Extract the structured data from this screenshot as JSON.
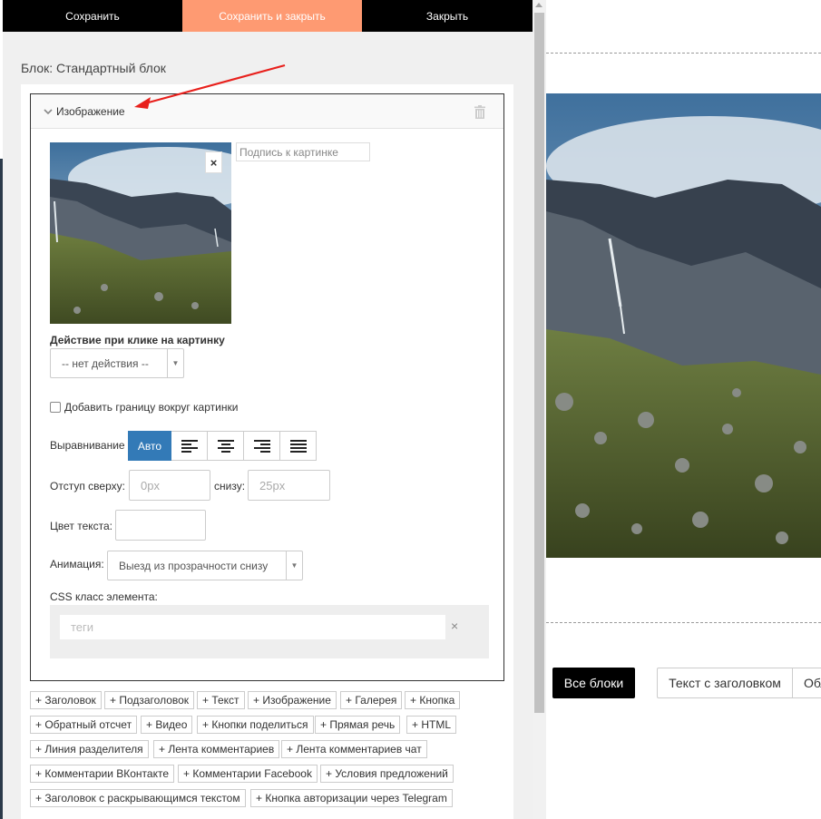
{
  "toolbar": {
    "save_label": "Сохранить",
    "save_close_label": "Сохранить и закрыть",
    "close_label": "Закрыть"
  },
  "block": {
    "title": "Блок: Стандартный блок"
  },
  "image_card": {
    "title": "Изображение",
    "remove_label": "×",
    "caption_placeholder": "Подпись к картинке",
    "click_action_label": "Действие при клике на картинку",
    "click_action_value": "-- нет действия --",
    "border_checkbox_label": "Добавить границу вокруг картинки",
    "border_checked": false,
    "align_label": "Выравнивание",
    "align_auto_label": "Авто",
    "margin_top_label": "Отступ сверху:",
    "margin_top_placeholder": "0px",
    "margin_bottom_label": "снизу:",
    "margin_bottom_placeholder": "25px",
    "text_color_label": "Цвет текста:",
    "animation_label": "Анимация:",
    "animation_value": "Выезд из прозрачности снизу",
    "css_class_label": "CSS класс элемента:",
    "tags_placeholder": "теги",
    "tags_clear": "×"
  },
  "add_buttons": [
    "+ Заголовок",
    "+ Подзаголовок",
    "+ Текст",
    "+ Изображение",
    "+ Галерея",
    "+ Кнопка",
    "+ Обратный отсчет",
    "+ Видео",
    "+ Кнопки поделиться",
    "+ Прямая речь",
    "+ HTML",
    "+ Линия разделителя",
    "+ Лента комментариев",
    "+ Лента комментариев чат",
    "+ Комментарии ВКонтакте",
    "+ Комментарии Facebook",
    "+ Условия предложений",
    "+ Заголовок с раскрывающимся текстом",
    "+ Кнопка авторизации через Telegram"
  ],
  "preview": {
    "all_blocks_label": "Все блоки",
    "text_with_heading_label": "Текст с заголовком",
    "partial_tab_label": "Обл"
  },
  "colors": {
    "accent": "#fe9a72",
    "primary_blue": "#337ab7",
    "arrow_red": "#e8201c"
  }
}
